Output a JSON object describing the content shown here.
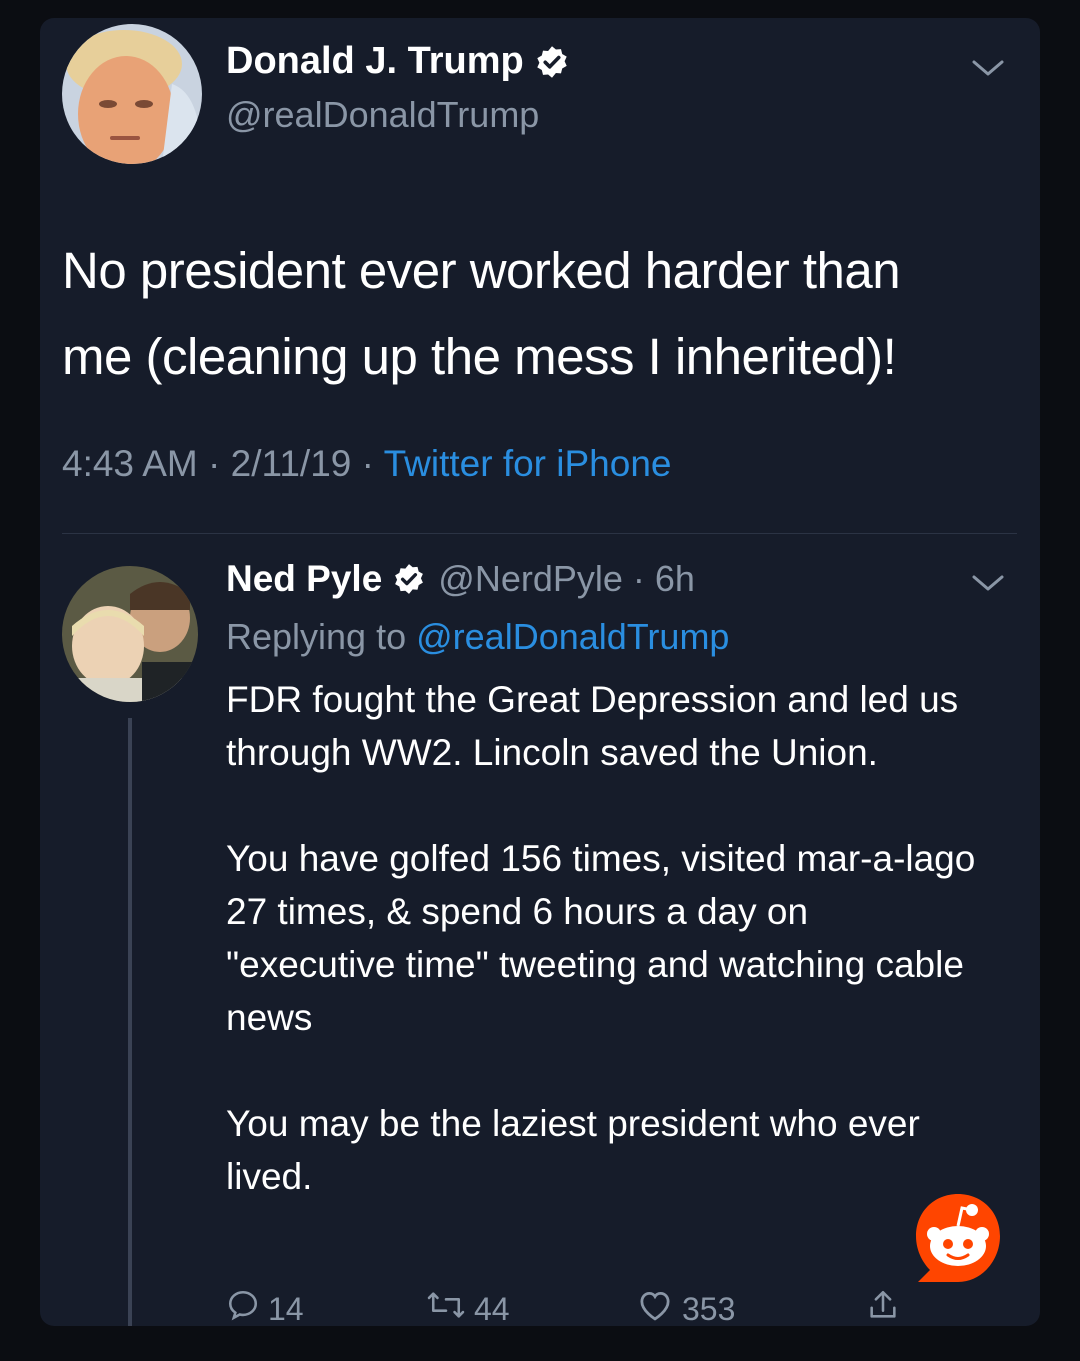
{
  "tweet": {
    "author_name": "Donald J. Trump",
    "author_handle": "@realDonaldTrump",
    "text_line1": "No president ever worked harder than",
    "text_line2": "me (cleaning up the mess I inherited)!",
    "time": "4:43 AM",
    "date": "2/11/19",
    "source": "Twitter for iPhone",
    "separator": " · "
  },
  "reply": {
    "author_name": "Ned Pyle",
    "author_handle": "@NerdPyle",
    "age": "6h",
    "separator": " · ",
    "replying_prefix": "Replying to",
    "replying_to": "@realDonaldTrump",
    "paragraph1": "FDR fought the Great Depression  and led us through WW2. Lincoln saved the Union.",
    "paragraph2": "You have golfed 156 times, visited mar-a-lago 27 times, & spend 6 hours a day on \"executive time\" tweeting and watching cable news",
    "paragraph3": "You may be the laziest president who ever lived.",
    "counts": {
      "replies": "14",
      "retweets": "44",
      "likes": "353"
    }
  },
  "icons": {
    "verified": "verified-badge-icon",
    "chevron": "chevron-down-icon",
    "reply": "reply-icon",
    "retweet": "retweet-icon",
    "like": "heart-icon",
    "share": "share-icon",
    "watermark": "reddit-logo-icon"
  },
  "colors": {
    "background": "#161c2a",
    "text": "#ffffff",
    "secondary": "#8a96a6",
    "link": "#2a8ee0",
    "reddit": "#ff4500"
  }
}
